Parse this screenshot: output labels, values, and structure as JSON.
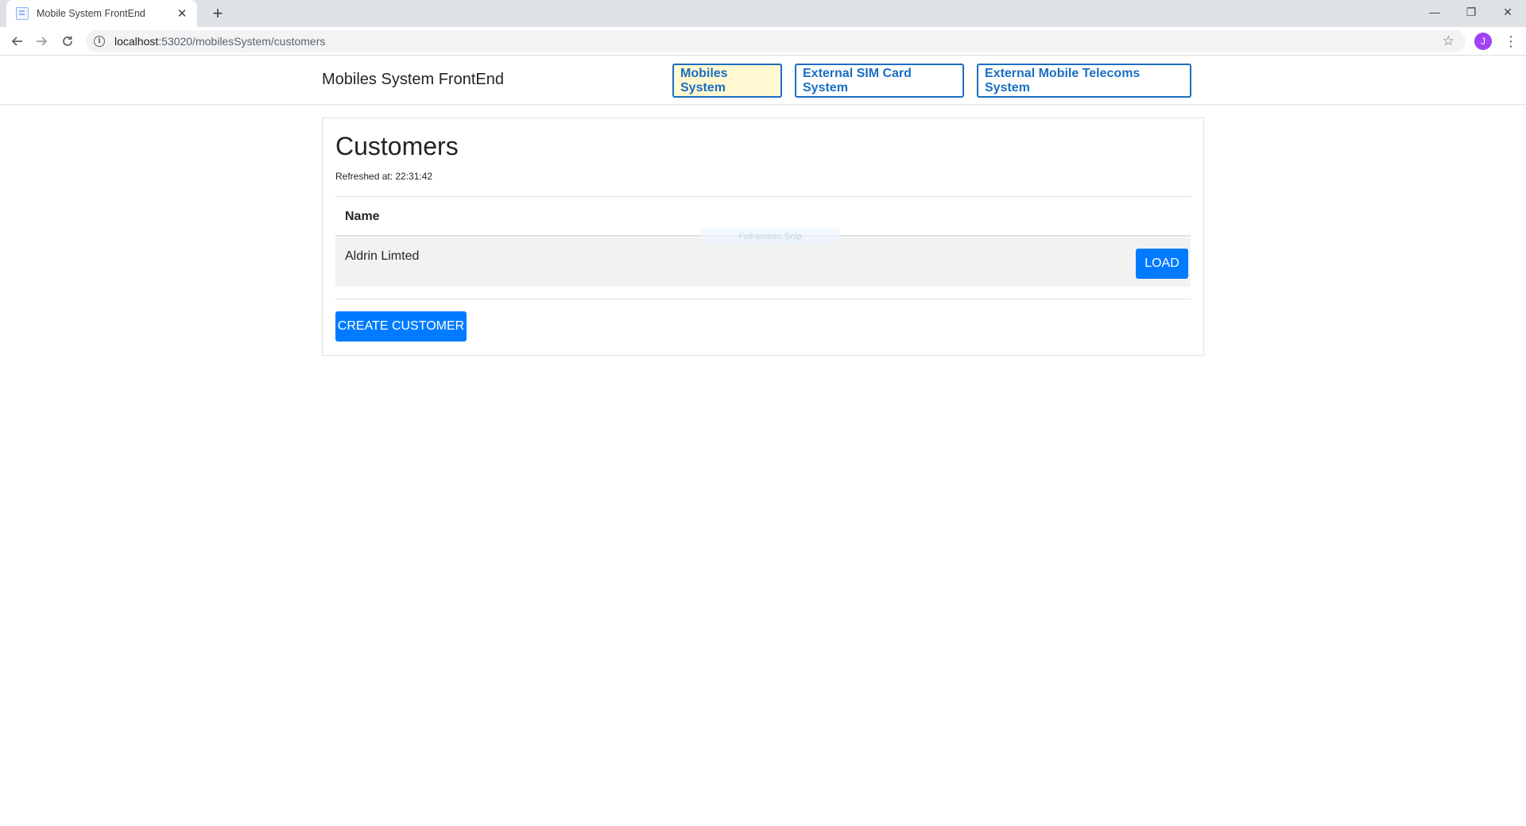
{
  "browser": {
    "tab_title": "Mobile System FrontEnd",
    "tab_close": "✕",
    "new_tab": "+",
    "url_host": "localhost",
    "url_path": ":53020/mobilesSystem/customers",
    "avatar_letter": "J",
    "window_controls": {
      "minimize": "—",
      "maximize": "❐",
      "close": "✕"
    }
  },
  "app": {
    "brand": "Mobiles System FrontEnd",
    "nav": [
      {
        "label": "Mobiles System",
        "active": true
      },
      {
        "label": "External SIM Card System",
        "active": false
      },
      {
        "label": "External Mobile Telecoms System",
        "active": false
      }
    ]
  },
  "customers": {
    "title": "Customers",
    "refreshed": "Refreshed at: 22:31:42",
    "columns": [
      "Name"
    ],
    "rows": [
      {
        "name": "Aldrin Limted",
        "action_label": "LOAD"
      }
    ],
    "create_label": "CREATE CUSTOMER"
  },
  "overlay": {
    "snip_hint": "Full-screen Snip"
  },
  "colors": {
    "accent": "#1b6ec2",
    "primary_button": "#007bff",
    "active_nav_bg": "#fff8d1",
    "row_bg": "#f2f2f2"
  }
}
